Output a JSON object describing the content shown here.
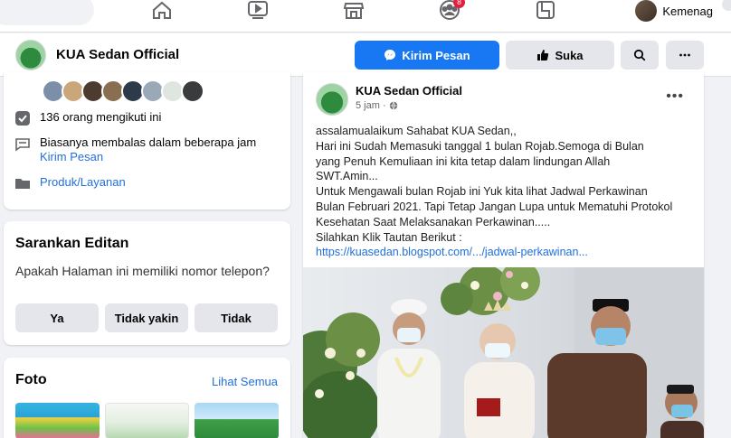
{
  "topnav": {
    "profile_name": "Kemenag",
    "notification_count": "8",
    "icons": [
      "home-icon",
      "watch-icon",
      "marketplace-icon",
      "groups-icon",
      "gaming-icon"
    ]
  },
  "page_header": {
    "page_name": "KUA Sedan Official",
    "message_button": "Kirim Pesan",
    "like_button": "Suka"
  },
  "about": {
    "followers": "136 orang mengikuti ini",
    "response_time": "Biasanya membalas dalam beberapa jam",
    "send_message_link": "Kirim Pesan",
    "products_link": "Produk/Layanan"
  },
  "suggest": {
    "title": "Sarankan Editan",
    "question": "Apakah Halaman ini memiliki nomor telepon?",
    "yes": "Ya",
    "not_sure": "Tidak yakin",
    "no": "Tidak"
  },
  "photos": {
    "title": "Foto",
    "see_all": "Lihat Semua"
  },
  "post": {
    "author": "KUA Sedan Official",
    "time": "5 jam ·",
    "lines": [
      "assalamualaikum Sahabat KUA Sedan,,",
      "Hari ini Sudah Memasuki tanggal 1 bulan  Rojab.Semoga di Bulan",
      "yang Penuh Kemuliaan ini kita tetap dalam lindungan Allah",
      "SWT.Amin...",
      "Untuk Mengawali bulan Rojab ini Yuk kita lihat Jadwal Perkawinan",
      "Bulan Februari 2021. Tapi Tetap Jangan Lupa untuk Mematuhi Protokol",
      "Kesehatan Saat Melaksanakan Perkawinan.....",
      "Silahkan Klik Tautan Berikut :"
    ],
    "link": "https://kuasedan.blogspot.com/.../jadwal-perkawinan..."
  },
  "colors": {
    "primary": "#1877f2",
    "link": "#216fdb",
    "secondary_button": "#e4e6eb",
    "page_bg": "#f0f2f5",
    "badge": "#e41e3f"
  }
}
